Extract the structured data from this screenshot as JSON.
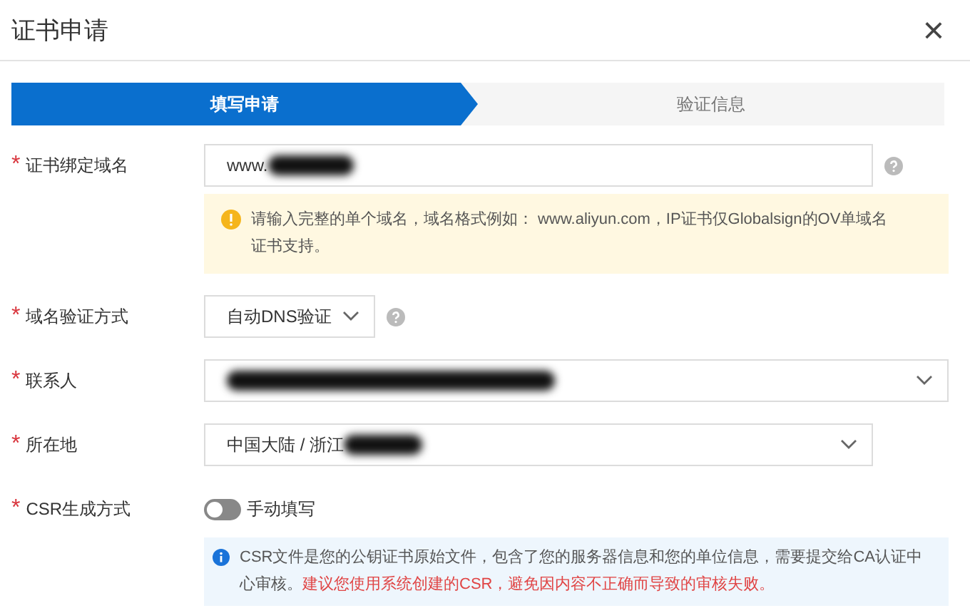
{
  "dialog": {
    "title": "证书申请",
    "close": "×"
  },
  "steps": [
    {
      "label": "填写申请",
      "selected": true
    },
    {
      "label": "验证信息",
      "selected": false
    }
  ],
  "fields": [
    {
      "kind": "input",
      "marker": "*",
      "label": "证书绑定域名",
      "value": "www.",
      "redacted": true,
      "help": true,
      "notice": {
        "kind": "warning",
        "text": "请输入完整的单个域名，域名格式例如： www.aliyun.com，IP证书仅Globalsign的OV单域名证书支持。"
      }
    },
    {
      "kind": "select",
      "marker": "*",
      "label": "域名验证方式",
      "value": "自动DNS验证",
      "help": true
    },
    {
      "kind": "select",
      "marker": "*",
      "label": "联系人",
      "redacted": true
    },
    {
      "kind": "select",
      "marker": "*",
      "label": "所在地",
      "value": "中国大陆 / 浙江",
      "redacted": true
    },
    {
      "kind": "switch",
      "marker": "*",
      "label": "CSR生成方式",
      "on": false,
      "value": "手动填写",
      "notice": {
        "kind": "info",
        "text": "CSR文件是您的公钥证书原始文件，包含了您的服务器信息和您的单位信息，需要提交给CA认证中心审核。",
        "alert": "建议您使用系统创建的CSR，避免因内容不正确而导致的审核失败。"
      }
    }
  ]
}
